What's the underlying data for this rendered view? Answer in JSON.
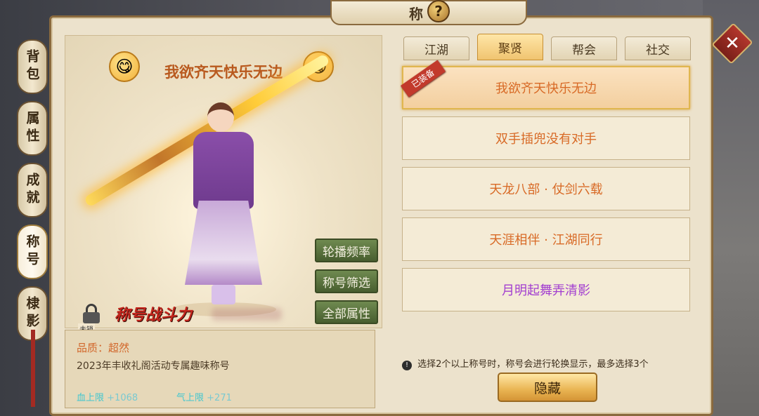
{
  "header": {
    "title": "称号",
    "help_glyph": "?",
    "close_glyph": "✕"
  },
  "side_tabs": [
    {
      "label": "背包"
    },
    {
      "label": "属性"
    },
    {
      "label": "成就"
    },
    {
      "label": "称号",
      "active": true
    },
    {
      "label": "棣影"
    }
  ],
  "preview": {
    "title": "我欲齐天快乐无边",
    "lock_label": "未锁",
    "power_label": "称号战斗力",
    "buttons": {
      "rotate_freq": "轮播频率",
      "filter": "称号筛选",
      "all_attrs": "全部属性"
    }
  },
  "info": {
    "quality": "品质：超然",
    "description": "2023年丰收礼阁活动专属趣味称号",
    "stats": [
      {
        "label": "血上限",
        "value": "+1068"
      },
      {
        "label": "气上限",
        "value": "+271"
      }
    ]
  },
  "tabs": [
    {
      "label": "江湖"
    },
    {
      "label": "聚贤",
      "active": true
    },
    {
      "label": "帮会"
    },
    {
      "label": "社交"
    }
  ],
  "titles": [
    {
      "label": "我欲齐天快乐无边",
      "selected": true,
      "badge": "已装备"
    },
    {
      "label": "双手插兜没有对手"
    },
    {
      "label": "天龙八部 · 仗剑六载"
    },
    {
      "label": "天涯相伴 · 江湖同行"
    },
    {
      "label": "月明起舞弄清影",
      "purple": true
    }
  ],
  "note": "选择2个以上称号时，称号会进行轮换显示，最多选择3个",
  "hide_button": "隐藏",
  "colors": {
    "accent_orange": "#d86a26",
    "purple_title": "#a23ed0",
    "stat_cyan": "#43c6cf",
    "green_button": "#5a7340"
  }
}
